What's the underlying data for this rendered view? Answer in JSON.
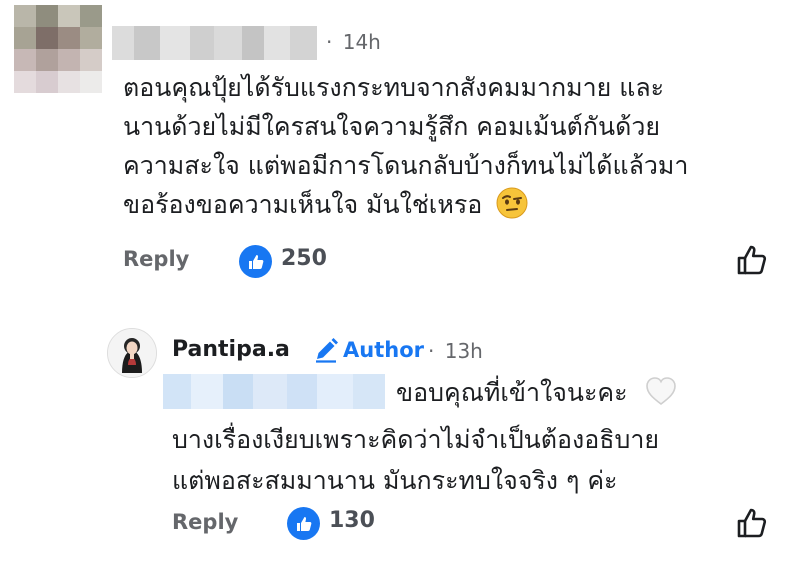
{
  "comment": {
    "time": "14h",
    "separator": "·",
    "lines": [
      "ตอนคุณปุ้ยได้รับแรงกระทบจากสังคมมากมาย และ",
      "นานด้วยไม่มีใครสนใจความรู้สึก คอมเม้นต์กันด้วย",
      "ความสะใจ แต่พอมีการโดนกลับบ้างก็ทนไม่ได้แล้วมา",
      "ขอร้องขอความเห็นใจ มันใช่เหรอ"
    ],
    "emoji": "raised-eyebrow-emoji",
    "reply_label": "Reply",
    "like_count": "250"
  },
  "reply": {
    "name": "Pantipa.a",
    "author_label": "Author",
    "separator": "·",
    "time": "13h",
    "lines": [
      "ขอบคุณที่เข้าใจนะคะ",
      "บางเรื่องเงียบเพราะคิดว่าไม่จำเป็นต้องอธิบาย",
      "แต่พอสะสมมานาน มันกระทบใจจริง ๆ ค่ะ"
    ],
    "emoji": "white-heart-emoji",
    "reply_label": "Reply",
    "like_count": "130"
  },
  "colors": {
    "accent": "#1877f2",
    "meta": "#65676b",
    "text": "#1c1e21"
  }
}
